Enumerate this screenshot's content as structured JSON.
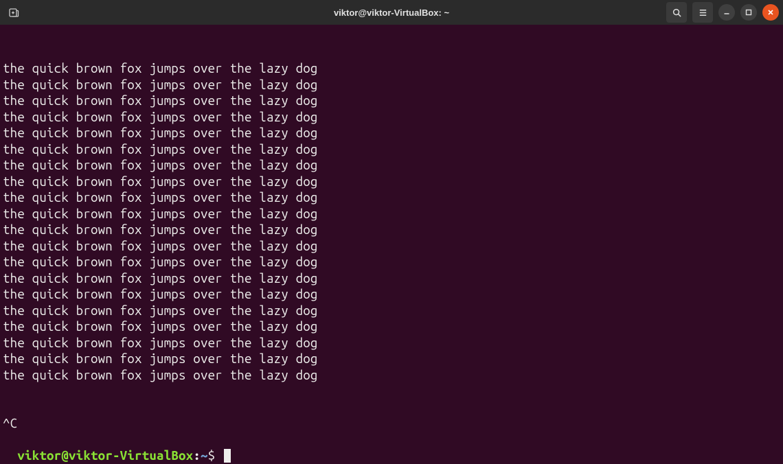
{
  "titlebar": {
    "tab_icon_name": "new-tab-icon",
    "title": "viktor@viktor-VirtualBox: ~",
    "search_icon_name": "search-icon",
    "menu_icon_name": "hamburger-menu-icon",
    "minimize_icon_name": "minimize-icon",
    "maximize_icon_name": "maximize-icon",
    "close_icon_name": "close-icon"
  },
  "terminal": {
    "output_lines": [
      "the quick brown fox jumps over the lazy dog",
      "the quick brown fox jumps over the lazy dog",
      "the quick brown fox jumps over the lazy dog",
      "the quick brown fox jumps over the lazy dog",
      "the quick brown fox jumps over the lazy dog",
      "the quick brown fox jumps over the lazy dog",
      "the quick brown fox jumps over the lazy dog",
      "the quick brown fox jumps over the lazy dog",
      "the quick brown fox jumps over the lazy dog",
      "the quick brown fox jumps over the lazy dog",
      "the quick brown fox jumps over the lazy dog",
      "the quick brown fox jumps over the lazy dog",
      "the quick brown fox jumps over the lazy dog",
      "the quick brown fox jumps over the lazy dog",
      "the quick brown fox jumps over the lazy dog",
      "the quick brown fox jumps over the lazy dog",
      "the quick brown fox jumps over the lazy dog",
      "the quick brown fox jumps over the lazy dog",
      "the quick brown fox jumps over the lazy dog",
      "the quick brown fox jumps over the lazy dog"
    ],
    "interrupt_line": "^C",
    "prompt": {
      "user": "viktor",
      "at": "@",
      "host": "viktor-VirtualBox",
      "colon": ":",
      "path": "~",
      "dollar": "$"
    }
  }
}
